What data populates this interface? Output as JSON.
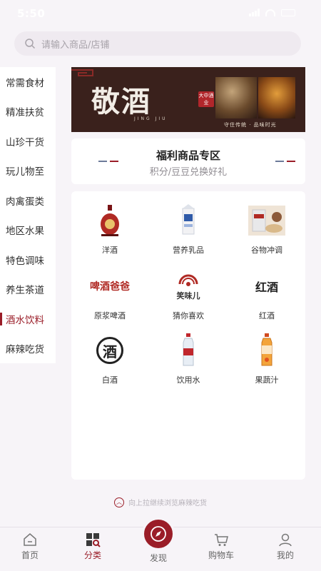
{
  "status": {
    "time": "5:50"
  },
  "search": {
    "placeholder": "请输入商品/店铺"
  },
  "sidebar": {
    "items": [
      {
        "label": "常需食材"
      },
      {
        "label": "精准扶贫"
      },
      {
        "label": "山珍干货"
      },
      {
        "label": "玩儿物至"
      },
      {
        "label": "肉禽蛋类"
      },
      {
        "label": "地区水果"
      },
      {
        "label": "特色调味"
      },
      {
        "label": "养生茶道"
      },
      {
        "label": "酒水饮料"
      },
      {
        "label": "麻辣吃货"
      }
    ],
    "active_index": 8
  },
  "banner": {
    "title": "敬酒",
    "sub": "JING JIU",
    "seal": "大中酒业",
    "slogan": "守住传统 · 品味时光"
  },
  "welfare": {
    "title": "福利商品专区",
    "subtitle": "积分/豆豆兑换好礼"
  },
  "products": [
    {
      "label": "洋酒",
      "icon": "foreign-liquor-bottle"
    },
    {
      "label": "营养乳品",
      "icon": "milk-carton"
    },
    {
      "label": "谷物冲调",
      "icon": "cereal-drink"
    },
    {
      "label": "原浆啤酒",
      "icon": "beer-logo"
    },
    {
      "label": "猜你喜欢",
      "icon": "recommend-logo"
    },
    {
      "label": "红酒",
      "icon": "red-wine-logo"
    },
    {
      "label": "白酒",
      "icon": "baijiu-logo"
    },
    {
      "label": "饮用水",
      "icon": "water-bottle"
    },
    {
      "label": "果蔬汁",
      "icon": "juice-bottle"
    }
  ],
  "product_images": {
    "beer_logo": "啤酒爸爸",
    "recommend_logo": "笑味儿",
    "wine_logo": "红酒",
    "baijiu_logo": "酒"
  },
  "hint": {
    "text": "向上拉继续浏览麻辣吃货"
  },
  "tabbar": {
    "tabs": [
      {
        "label": "首页",
        "icon": "home-icon"
      },
      {
        "label": "分类",
        "icon": "category-icon"
      },
      {
        "label": "发现",
        "icon": "compass-icon"
      },
      {
        "label": "购物车",
        "icon": "cart-icon"
      },
      {
        "label": "我的",
        "icon": "user-icon"
      }
    ],
    "active_index": 1
  },
  "colors": {
    "accent": "#9a1d28",
    "background": "#f7f4f8"
  }
}
